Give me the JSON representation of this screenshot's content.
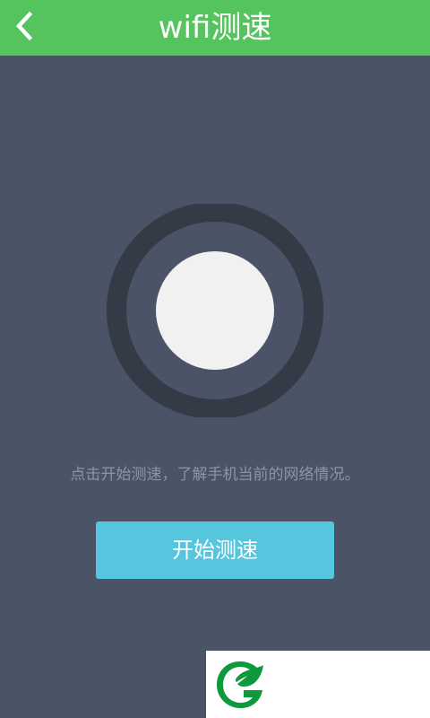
{
  "header": {
    "title": "wifi测速",
    "back_icon": "chevron-left-icon",
    "bar_color": "#55c35e"
  },
  "main": {
    "hint": "点击开始测速，了解手机当前的网络情况。",
    "start_button_label": "开始测速",
    "button_color": "#56c6df",
    "background_color": "#4b5366"
  },
  "watermark": {
    "logo_icon": "leaf-g-logo-icon",
    "logo_color": "#0e9a3c"
  }
}
